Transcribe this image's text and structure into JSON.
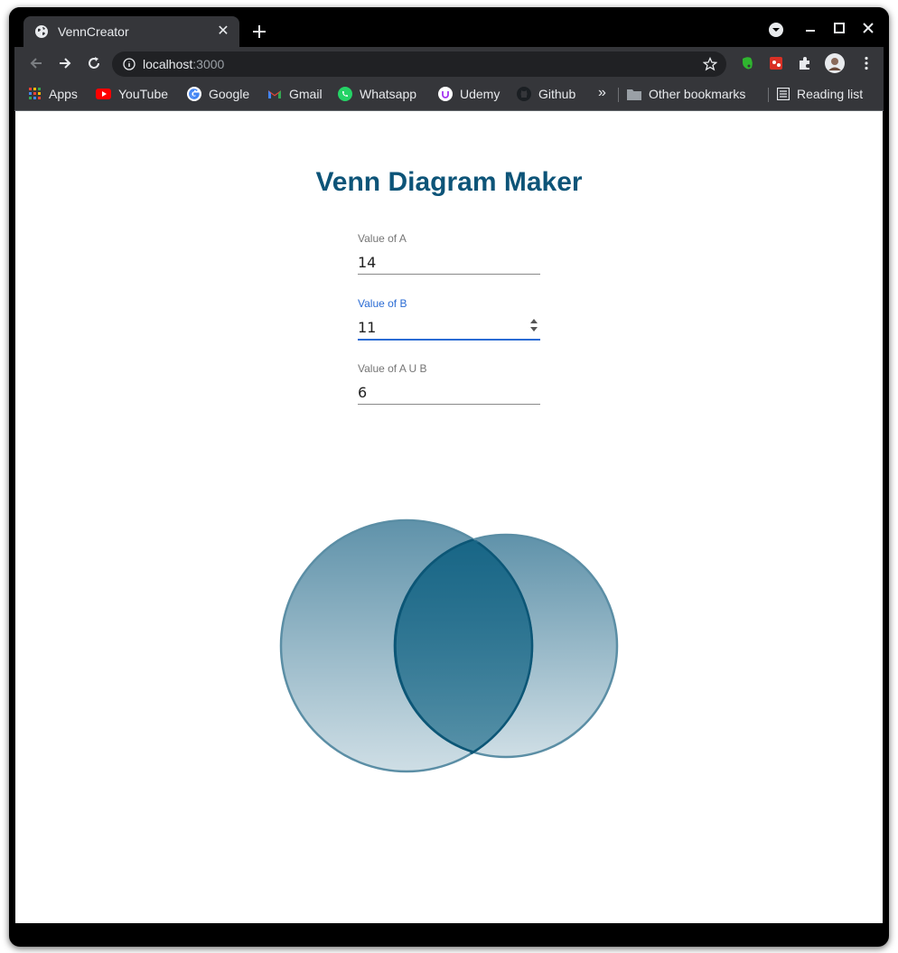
{
  "browser": {
    "tab_title": "VennCreator",
    "url_host": "localhost",
    "url_port": ":3000",
    "bookmarks": [
      "Apps",
      "YouTube",
      "Google",
      "Gmail",
      "Whatsapp",
      "Udemy",
      "Github"
    ],
    "overflow": "»",
    "other_bookmarks": "Other bookmarks",
    "reading_list": "Reading list"
  },
  "page": {
    "title": "Venn Diagram Maker",
    "fields": [
      {
        "label": "Value of A",
        "value": "14"
      },
      {
        "label": "Value of B",
        "value": "11"
      },
      {
        "label": "Value of A U B",
        "value": "6"
      }
    ]
  },
  "diagram": {
    "fill_color": "#0d5a7e",
    "overlap_color": "#005a7c",
    "stroke_color": "#5b8ea5"
  }
}
